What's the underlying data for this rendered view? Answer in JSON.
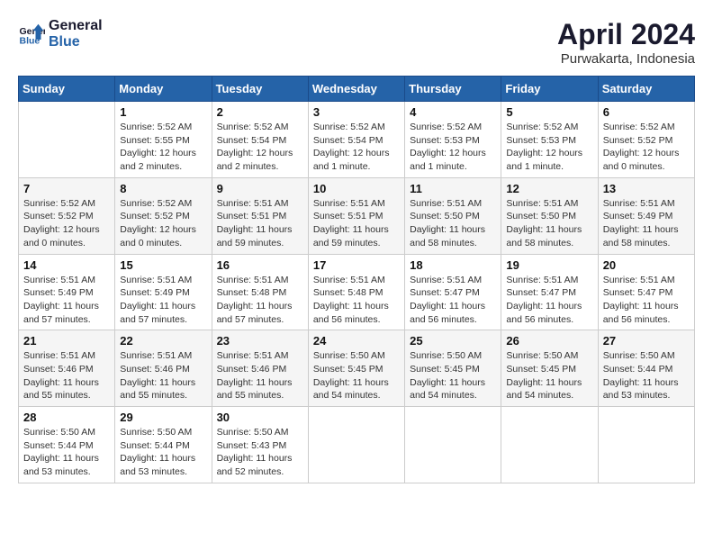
{
  "header": {
    "logo_line1": "General",
    "logo_line2": "Blue",
    "month_year": "April 2024",
    "location": "Purwakarta, Indonesia"
  },
  "weekdays": [
    "Sunday",
    "Monday",
    "Tuesday",
    "Wednesday",
    "Thursday",
    "Friday",
    "Saturday"
  ],
  "weeks": [
    [
      {
        "day": "",
        "info": ""
      },
      {
        "day": "1",
        "info": "Sunrise: 5:52 AM\nSunset: 5:55 PM\nDaylight: 12 hours\nand 2 minutes."
      },
      {
        "day": "2",
        "info": "Sunrise: 5:52 AM\nSunset: 5:54 PM\nDaylight: 12 hours\nand 2 minutes."
      },
      {
        "day": "3",
        "info": "Sunrise: 5:52 AM\nSunset: 5:54 PM\nDaylight: 12 hours\nand 1 minute."
      },
      {
        "day": "4",
        "info": "Sunrise: 5:52 AM\nSunset: 5:53 PM\nDaylight: 12 hours\nand 1 minute."
      },
      {
        "day": "5",
        "info": "Sunrise: 5:52 AM\nSunset: 5:53 PM\nDaylight: 12 hours\nand 1 minute."
      },
      {
        "day": "6",
        "info": "Sunrise: 5:52 AM\nSunset: 5:52 PM\nDaylight: 12 hours\nand 0 minutes."
      }
    ],
    [
      {
        "day": "7",
        "info": "Sunrise: 5:52 AM\nSunset: 5:52 PM\nDaylight: 12 hours\nand 0 minutes."
      },
      {
        "day": "8",
        "info": "Sunrise: 5:52 AM\nSunset: 5:52 PM\nDaylight: 12 hours\nand 0 minutes."
      },
      {
        "day": "9",
        "info": "Sunrise: 5:51 AM\nSunset: 5:51 PM\nDaylight: 11 hours\nand 59 minutes."
      },
      {
        "day": "10",
        "info": "Sunrise: 5:51 AM\nSunset: 5:51 PM\nDaylight: 11 hours\nand 59 minutes."
      },
      {
        "day": "11",
        "info": "Sunrise: 5:51 AM\nSunset: 5:50 PM\nDaylight: 11 hours\nand 58 minutes."
      },
      {
        "day": "12",
        "info": "Sunrise: 5:51 AM\nSunset: 5:50 PM\nDaylight: 11 hours\nand 58 minutes."
      },
      {
        "day": "13",
        "info": "Sunrise: 5:51 AM\nSunset: 5:49 PM\nDaylight: 11 hours\nand 58 minutes."
      }
    ],
    [
      {
        "day": "14",
        "info": "Sunrise: 5:51 AM\nSunset: 5:49 PM\nDaylight: 11 hours\nand 57 minutes."
      },
      {
        "day": "15",
        "info": "Sunrise: 5:51 AM\nSunset: 5:49 PM\nDaylight: 11 hours\nand 57 minutes."
      },
      {
        "day": "16",
        "info": "Sunrise: 5:51 AM\nSunset: 5:48 PM\nDaylight: 11 hours\nand 57 minutes."
      },
      {
        "day": "17",
        "info": "Sunrise: 5:51 AM\nSunset: 5:48 PM\nDaylight: 11 hours\nand 56 minutes."
      },
      {
        "day": "18",
        "info": "Sunrise: 5:51 AM\nSunset: 5:47 PM\nDaylight: 11 hours\nand 56 minutes."
      },
      {
        "day": "19",
        "info": "Sunrise: 5:51 AM\nSunset: 5:47 PM\nDaylight: 11 hours\nand 56 minutes."
      },
      {
        "day": "20",
        "info": "Sunrise: 5:51 AM\nSunset: 5:47 PM\nDaylight: 11 hours\nand 56 minutes."
      }
    ],
    [
      {
        "day": "21",
        "info": "Sunrise: 5:51 AM\nSunset: 5:46 PM\nDaylight: 11 hours\nand 55 minutes."
      },
      {
        "day": "22",
        "info": "Sunrise: 5:51 AM\nSunset: 5:46 PM\nDaylight: 11 hours\nand 55 minutes."
      },
      {
        "day": "23",
        "info": "Sunrise: 5:51 AM\nSunset: 5:46 PM\nDaylight: 11 hours\nand 55 minutes."
      },
      {
        "day": "24",
        "info": "Sunrise: 5:50 AM\nSunset: 5:45 PM\nDaylight: 11 hours\nand 54 minutes."
      },
      {
        "day": "25",
        "info": "Sunrise: 5:50 AM\nSunset: 5:45 PM\nDaylight: 11 hours\nand 54 minutes."
      },
      {
        "day": "26",
        "info": "Sunrise: 5:50 AM\nSunset: 5:45 PM\nDaylight: 11 hours\nand 54 minutes."
      },
      {
        "day": "27",
        "info": "Sunrise: 5:50 AM\nSunset: 5:44 PM\nDaylight: 11 hours\nand 53 minutes."
      }
    ],
    [
      {
        "day": "28",
        "info": "Sunrise: 5:50 AM\nSunset: 5:44 PM\nDaylight: 11 hours\nand 53 minutes."
      },
      {
        "day": "29",
        "info": "Sunrise: 5:50 AM\nSunset: 5:44 PM\nDaylight: 11 hours\nand 53 minutes."
      },
      {
        "day": "30",
        "info": "Sunrise: 5:50 AM\nSunset: 5:43 PM\nDaylight: 11 hours\nand 52 minutes."
      },
      {
        "day": "",
        "info": ""
      },
      {
        "day": "",
        "info": ""
      },
      {
        "day": "",
        "info": ""
      },
      {
        "day": "",
        "info": ""
      }
    ]
  ]
}
